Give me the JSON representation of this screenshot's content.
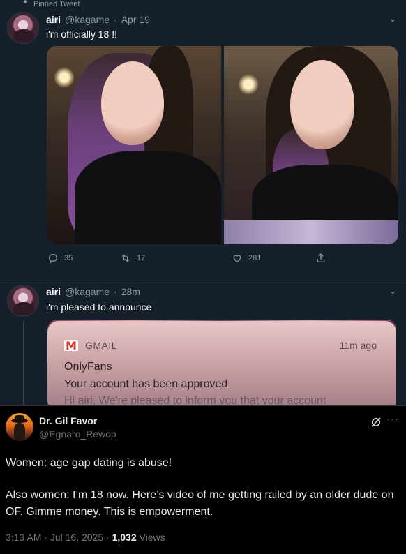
{
  "embed": {
    "pinned_label": "Pinned Tweet",
    "tweet1": {
      "name": "airi",
      "handle": "@kagame",
      "date": "Apr 19",
      "text": "i'm officially 18 !!",
      "replies": "35",
      "retweets": "17",
      "likes": "281"
    },
    "tweet2": {
      "name": "airi",
      "handle": "@kagame",
      "date": "28m",
      "text": "i'm pleased to announce"
    },
    "gmail": {
      "app": "GMAIL",
      "time": "11m ago",
      "sender": "OnlyFans",
      "subject": "Your account has been approved",
      "preview": "Hi airi, We're pleased to inform you that your account"
    }
  },
  "post": {
    "author_name": "Dr. Gil Favor",
    "author_handle": "@Egnaro_Rewop",
    "line1": "Women: age gap dating is abuse!",
    "line2": "Also women: I’m 18 now. Here’s video of me getting railed by an older dude on OF. Gimme money. This is empowerment.",
    "time": "3:13 AM",
    "date": "Jul 16, 2025",
    "views_count": "1,032",
    "views_label": "Views"
  }
}
